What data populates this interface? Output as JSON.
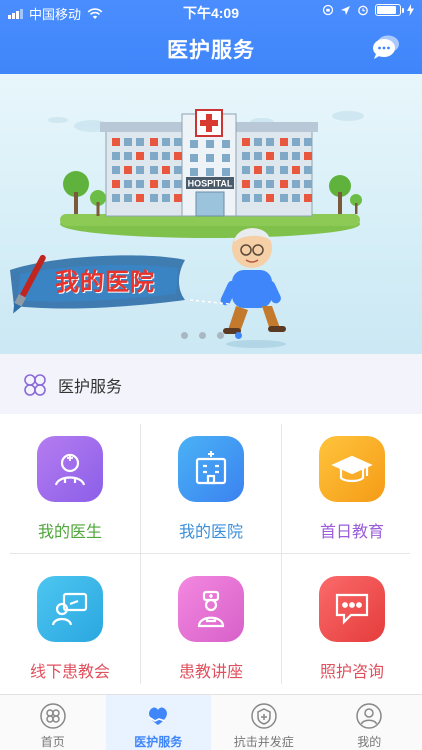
{
  "status_bar": {
    "carrier": "中国移动",
    "time": "下午4:09"
  },
  "header": {
    "title": "医护服务",
    "chat_icon": "chat-bubbles-icon"
  },
  "banner": {
    "label": "我的医院",
    "sign": "HOSPITAL",
    "dots": 4,
    "active_dot": 4
  },
  "section": {
    "title": "医护服务",
    "icon": "grid-icon"
  },
  "services": [
    {
      "label": "我的医生",
      "icon": "doctor-icon",
      "color_from": "#b57cf0",
      "color_to": "#8b5fe8",
      "label_color": "#4fa63a"
    },
    {
      "label": "我的医院",
      "icon": "hospital-icon",
      "color_from": "#4ab2f5",
      "color_to": "#3b82f0",
      "label_color": "#3b8fd8"
    },
    {
      "label": "首日教育",
      "icon": "graduation-cap-icon",
      "color_from": "#ffc43d",
      "color_to": "#f59b16",
      "label_color": "#9a5fd8"
    },
    {
      "label": "线下患教会",
      "icon": "meeting-icon",
      "color_from": "#4dc6f0",
      "color_to": "#2aa7e0",
      "label_color": "#e0515e"
    },
    {
      "label": "患教讲座",
      "icon": "nurse-icon",
      "color_from": "#f388e0",
      "color_to": "#d760c9",
      "label_color": "#e0515e"
    },
    {
      "label": "照护咨询",
      "icon": "consult-chat-icon",
      "color_from": "#fb6a6a",
      "color_to": "#e53c3c",
      "label_color": "#e0515e"
    }
  ],
  "tabs": [
    {
      "label": "首页",
      "icon": "home-grid-icon"
    },
    {
      "label": "医护服务",
      "icon": "heart-hands-icon",
      "active": true
    },
    {
      "label": "抗击并发症",
      "icon": "shield-plus-icon"
    },
    {
      "label": "我的",
      "icon": "profile-icon"
    }
  ],
  "colors": {
    "accent": "#3f86fa"
  }
}
